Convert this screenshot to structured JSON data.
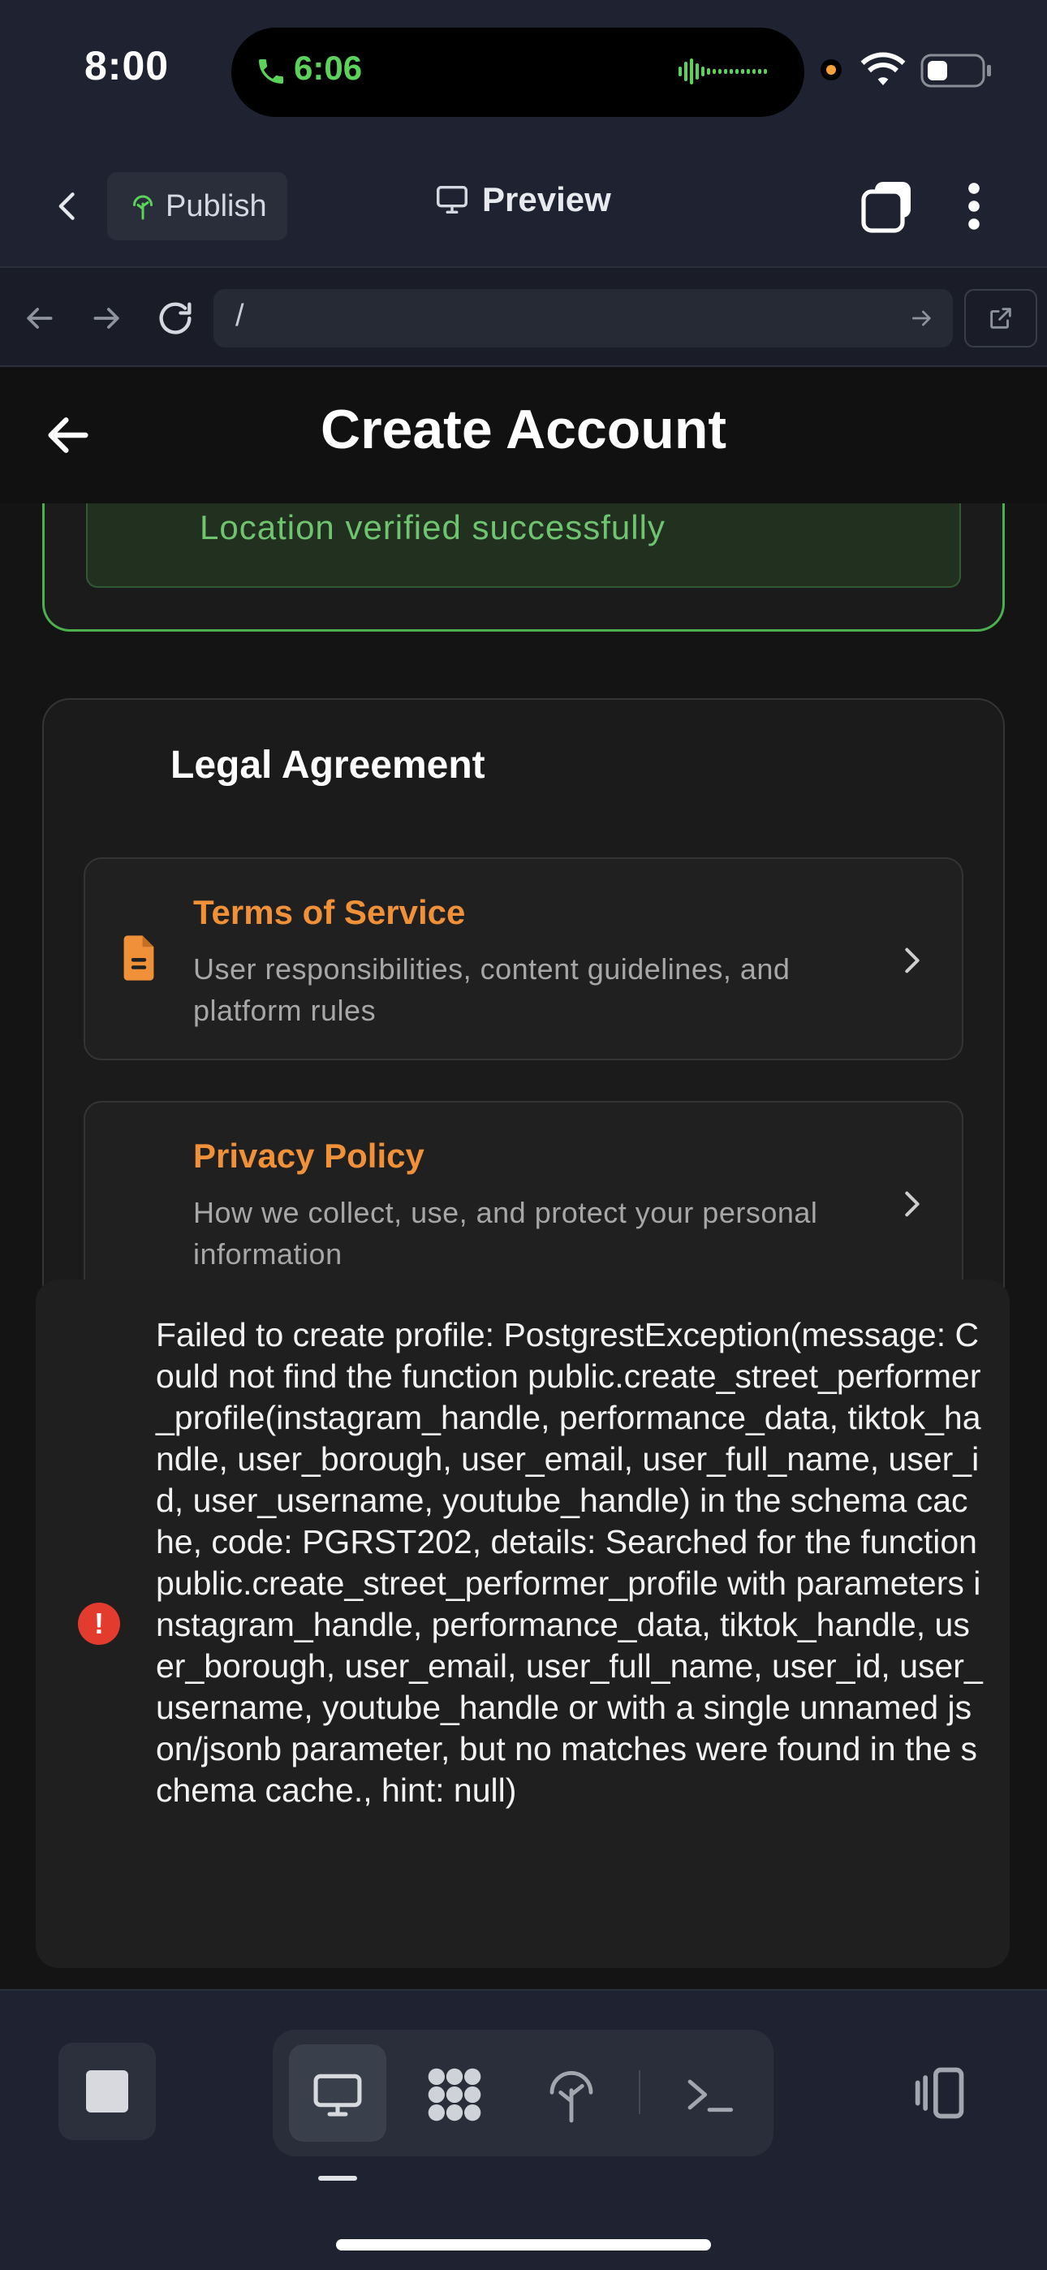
{
  "status_bar": {
    "time": "8:00",
    "call_time": "6:06",
    "icons": [
      "phone-icon",
      "waveform-icon",
      "recording-dot",
      "wifi-icon",
      "battery-icon"
    ],
    "call_color": "#5bd35b"
  },
  "toolbar": {
    "back_icon": "chevron-left-icon",
    "publish_label": "Publish",
    "preview_label": "Preview",
    "icons": [
      "publish-tree-icon",
      "monitor-icon",
      "tabs-icon",
      "more-vertical-icon"
    ]
  },
  "url_bar": {
    "url": "/",
    "icons": [
      "arrow-left-icon",
      "arrow-right-icon",
      "reload-icon",
      "go-arrow-icon",
      "open-external-icon"
    ]
  },
  "app": {
    "title": "Create Account",
    "back_icon": "arrow-left-icon",
    "location_status": "Location verified successfully",
    "legal": {
      "title": "Legal Agreement",
      "items": [
        {
          "title": "Terms of Service",
          "description": "User responsibilities, content guidelines, and platform rules",
          "icon": "document-icon"
        },
        {
          "title": "Privacy Policy",
          "description": "How we collect, use, and protect your personal information",
          "icon": ""
        }
      ]
    },
    "accent_color": "#f0913a",
    "success_color": "#6ec46f"
  },
  "error_toast": {
    "icon": "error-icon",
    "message": "Failed to create profile: PostgrestException(message: Could not find the function public.create_street_performer_profile(instagram_handle, performance_data, tiktok_handle, user_borough, user_email, user_full_name, user_id, user_username, youtube_handle) in the schema cache, code: PGRST202, details: Searched for the function public.create_street_performer_profile with parameters instagram_handle, performance_data, tiktok_handle, user_borough, user_email, user_full_name, user_id, user_username, youtube_handle or with a single unnamed json/jsonb parameter, but no matches were found in the schema cache., hint: null)",
    "color": "#e33b2e"
  },
  "dock": {
    "icons": [
      "stop-icon",
      "desktop-icon",
      "grid-apps-icon",
      "publish-tree-icon",
      "terminal-icon",
      "device-switch-icon"
    ],
    "active_tab": "desktop"
  }
}
